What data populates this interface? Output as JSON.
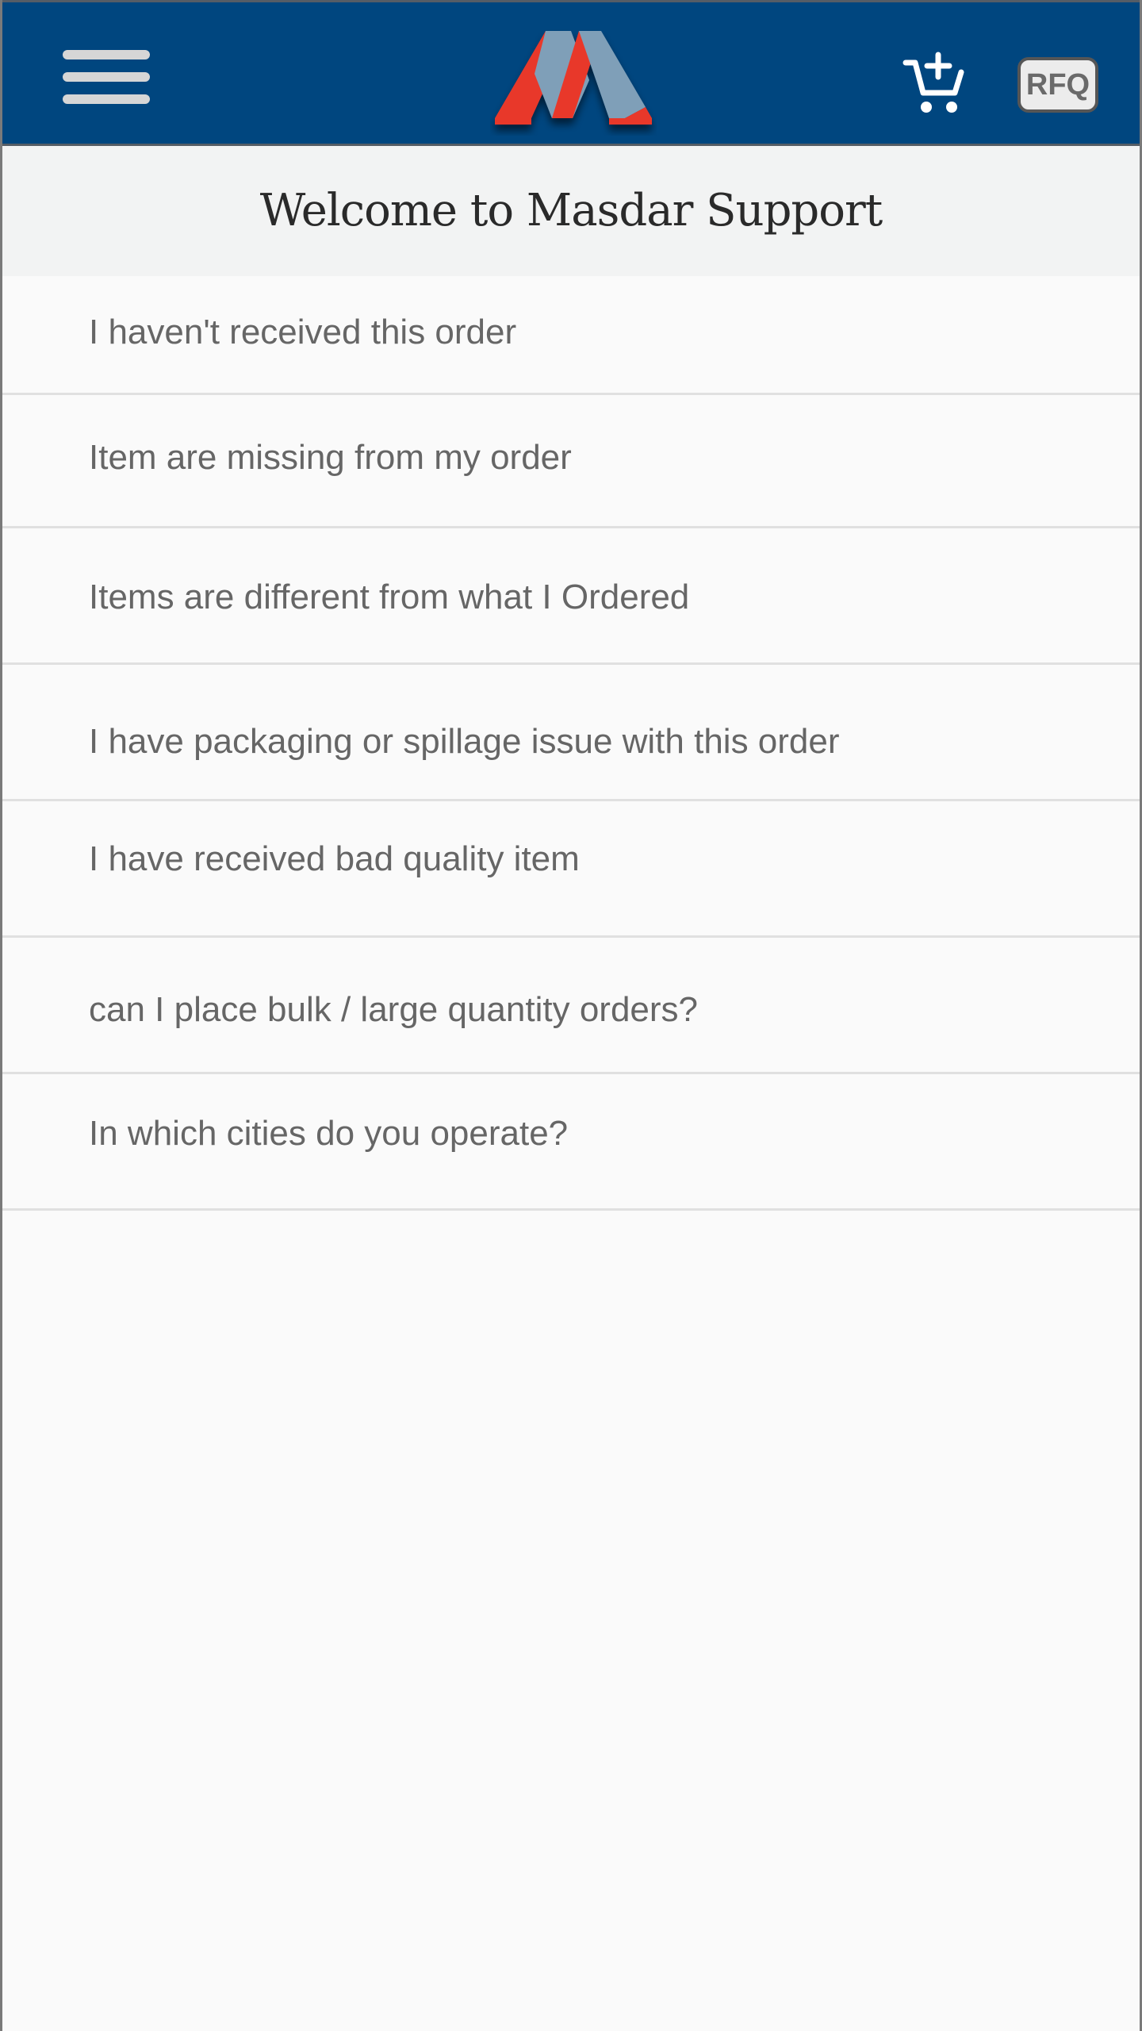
{
  "header": {
    "menu_icon": "hamburger-menu-icon",
    "logo": "masdar-logo",
    "cart_icon": "cart-add-icon",
    "rfq_label": "RFQ",
    "colors": {
      "bar_background": "#00467f",
      "logo_red": "#e8392b",
      "logo_blue": "#7f9fb8"
    }
  },
  "welcome": {
    "title": "Welcome to Masdar Support"
  },
  "support": {
    "items": [
      {
        "label": "I haven't received this order"
      },
      {
        "label": "Item are missing from my order"
      },
      {
        "label": "Items are different from what I Ordered"
      },
      {
        "label": "I have packaging or spillage issue with this order"
      },
      {
        "label": "I have received bad quality item"
      },
      {
        "label": "can I place bulk / large quantity orders?"
      },
      {
        "label": "In which cities do you operate?"
      }
    ]
  }
}
